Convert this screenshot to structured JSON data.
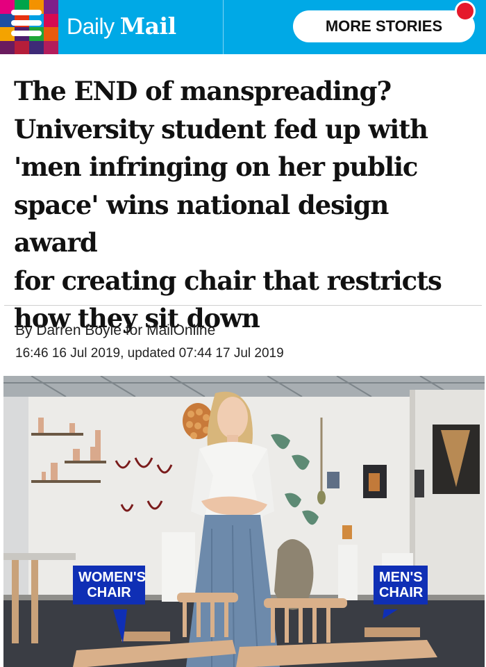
{
  "header": {
    "logo_daily": "Daily",
    "logo_mail": "Mail",
    "more_stories": "MORE STORIES",
    "menu_icon": "hamburger-menu-icon",
    "brand_color": "#00a9e6",
    "notification_color": "#e5192b"
  },
  "article": {
    "headline_lines": [
      "The END of manspreading?",
      "University student fed up with",
      "'men infringing on her public",
      "space' wins national design award",
      "for creating chair that restricts",
      "how they sit down"
    ],
    "byline": "By Darren Boyle for MailOnline",
    "dateline": "16:46 16 Jul 2019, updated 07:44 17 Jul 2019"
  },
  "photo": {
    "callouts": [
      {
        "line1": "WOMEN'S",
        "line2": "CHAIR"
      },
      {
        "line1": "MEN'S",
        "line2": "CHAIR"
      }
    ],
    "callout_color": "#0f2fb5"
  }
}
